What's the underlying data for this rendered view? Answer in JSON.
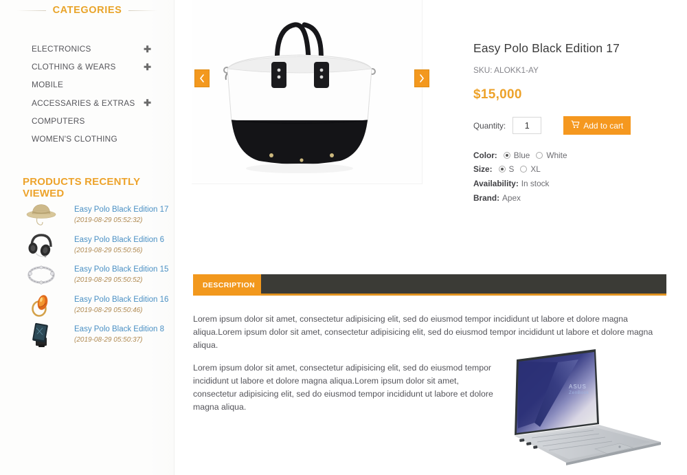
{
  "sidebar": {
    "categories_heading": "CATEGORIES",
    "categories": [
      {
        "label": "ELECTRONICS",
        "expandable": true,
        "icon": "plus-icon"
      },
      {
        "label": "CLOTHING & WEARS",
        "expandable": true,
        "icon": "plus-icon"
      },
      {
        "label": "MOBILE",
        "expandable": false,
        "icon": ""
      },
      {
        "label": "ACCESSARIES & EXTRAS",
        "expandable": true,
        "icon": "plus-icon"
      },
      {
        "label": "COMPUTERS",
        "expandable": false,
        "icon": ""
      },
      {
        "label": "WOMEN'S CLOTHING",
        "expandable": false,
        "icon": ""
      }
    ],
    "recently_viewed_heading": "PRODUCTS RECENTLY VIEWED",
    "recently_viewed": [
      {
        "title": "Easy Polo Black Edition 17",
        "date": "(2019-08-29 05:52:32)",
        "thumb": "straw-hat-thumbnail"
      },
      {
        "title": "Easy Polo Black Edition 6",
        "date": "(2019-08-29 05:50:56)",
        "thumb": "headphones-thumbnail"
      },
      {
        "title": "Easy Polo Black Edition 15",
        "date": "(2019-08-29 05:50:52)",
        "thumb": "bracelet-thumbnail"
      },
      {
        "title": "Easy Polo Black Edition 16",
        "date": "(2019-08-29 05:50:46)",
        "thumb": "gemstone-ring-thumbnail"
      },
      {
        "title": "Easy Polo Black Edition 8",
        "date": "(2019-08-29 05:50:37)",
        "thumb": "phone-holder-thumbnail"
      }
    ]
  },
  "gallery": {
    "main_image": "white-black-handbag",
    "prev_icon": "chevron-left-icon",
    "next_icon": "chevron-right-icon"
  },
  "product": {
    "title": "Easy Polo Black Edition 17",
    "sku_line": "SKU: ALOKK1-AY",
    "price": "$15,000",
    "quantity_label": "Quantity:",
    "quantity_value": "1",
    "add_to_cart_label": "Add to cart",
    "cart_icon": "shopping-cart-icon",
    "color_label": "Color:",
    "color_options": [
      {
        "label": "Blue",
        "selected": true
      },
      {
        "label": "White",
        "selected": false
      }
    ],
    "size_label": "Size:",
    "size_options": [
      {
        "label": "S",
        "selected": true
      },
      {
        "label": "XL",
        "selected": false
      }
    ],
    "availability_label": "Availability:",
    "availability_value": "In stock",
    "brand_label": "Brand:",
    "brand_value": "Apex"
  },
  "tabs": {
    "active_label": "DESCRIPTION"
  },
  "description": {
    "paragraph_1": "Lorem ipsum dolor sit amet, consectetur adipisicing elit, sed do eiusmod tempor incididunt ut labore et dolore magna aliqua.Lorem ipsum dolor sit amet, consectetur adipisicing elit, sed do eiusmod tempor incididunt ut labore et dolore magna aliqua.",
    "paragraph_2": "Lorem ipsum dolor sit amet, consectetur adipisicing elit, sed do eiusmod tempor incididunt ut labore et dolore magna aliqua.Lorem ipsum dolor sit amet, consectetur adipisicing elit, sed do eiusmod tempor incididunt ut labore et dolore magna aliqua.",
    "image": "silver-laptop-photo"
  },
  "colors": {
    "accent_orange": "#f2981d",
    "heading_gold": "#eda32b",
    "link_blue": "#4a90c4",
    "date_brown": "#b08a52",
    "tabbar_dark": "#3b3b36"
  }
}
